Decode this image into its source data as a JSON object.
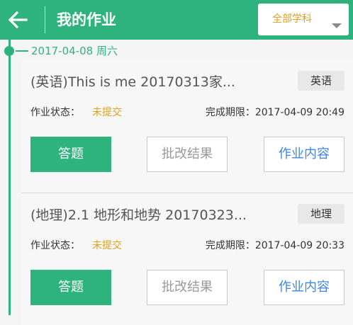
{
  "header": {
    "title": "我的作业",
    "subject_filter": "全部学科",
    "accent_color": "#2eb37f"
  },
  "timeline": {
    "date": "2017-04-08",
    "weekday": "周六"
  },
  "homework": [
    {
      "title": "(英语)This is me  20170313家...",
      "subject": "英语",
      "status_label": "作业状态：",
      "status": "未提交",
      "deadline": "完成期限：2017-04-09 20:49",
      "answer_label": "答题",
      "result_label": "批改结果",
      "content_label": "作业内容"
    },
    {
      "title": "(地理)2.1 地形和地势 20170323...",
      "subject": "地理",
      "status_label": "作业状态：",
      "status": "未提交",
      "deadline": "完成期限：2017-04-09 20:33",
      "answer_label": "答题",
      "result_label": "批改结果",
      "content_label": "作业内容"
    }
  ],
  "icons": {
    "back": "arrow-left",
    "dropdown": "triangle-down"
  }
}
